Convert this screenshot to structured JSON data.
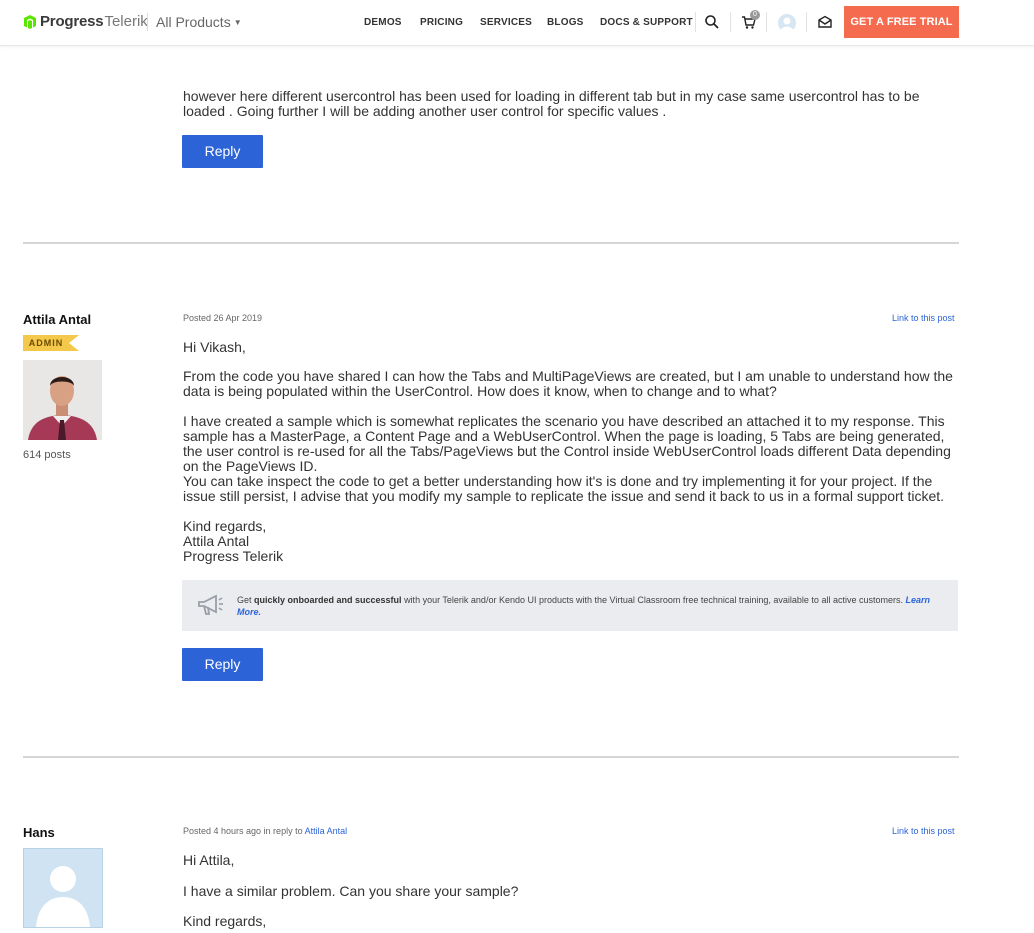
{
  "header": {
    "logo_text": "Progress",
    "logo_sub": "Telerik",
    "all_products": "All Products",
    "nav": [
      "DEMOS",
      "PRICING",
      "SERVICES",
      "BLOGS",
      "DOCS & SUPPORT"
    ],
    "cart_count": "0",
    "cta": "GET A FREE TRIAL"
  },
  "post1": {
    "text": "however here different usercontrol has been used for loading in different tab but in my case same usercontrol has to be loaded . Going further I will be adding another user control for specific values .",
    "reply": "Reply"
  },
  "post2": {
    "author": "Attila Antal",
    "badge": "ADMIN",
    "posts_count": "614 posts",
    "meta": "Posted 26 Apr 2019",
    "link": "Link to this post",
    "greeting": "Hi Vikash,",
    "p1": "From the code you have shared I can how the Tabs and MultiPageViews are created, but I am unable to understand how the data is being populated within the UserControl. How does it know, when to change and to what?",
    "p2": "I have created a sample which is somewhat replicates the scenario you have described an attached it to my response. This sample has a MasterPage, a Content Page and a WebUserControl. When the page is loading, 5 Tabs are being generated, the user control is re-used for all the Tabs/PageViews but the Control inside WebUserControl loads different Data depending on the PageViews ID.",
    "p3": "You can take inspect the code to get a better understanding how it's is done and try implementing it for your project. If the issue still persist, I advise that you modify my sample to replicate the issue and send it back to us in a formal support ticket.",
    "sign1": "Kind regards,",
    "sign2": "Attila Antal",
    "sign3": "Progress Telerik",
    "promo_pre": "Get ",
    "promo_bold": "quickly onboarded and successful",
    "promo_mid": " with your Telerik and/or Kendo UI products with the Virtual Classroom free technical training, available to all active customers. ",
    "promo_link": "Learn More.",
    "reply": "Reply"
  },
  "post3": {
    "author": "Hans",
    "meta_pre": "Posted 4 hours ago in reply to ",
    "meta_link": "Attila Antal",
    "link": "Link to this post",
    "greeting": "Hi Attila,",
    "p1": "I have a similar problem. Can you share your sample?",
    "sign1": "Kind regards,"
  },
  "colors": {
    "brand_green": "#5ce500",
    "cta": "#f56b50",
    "reply": "#2c64d8",
    "badge": "#f4c84a"
  }
}
